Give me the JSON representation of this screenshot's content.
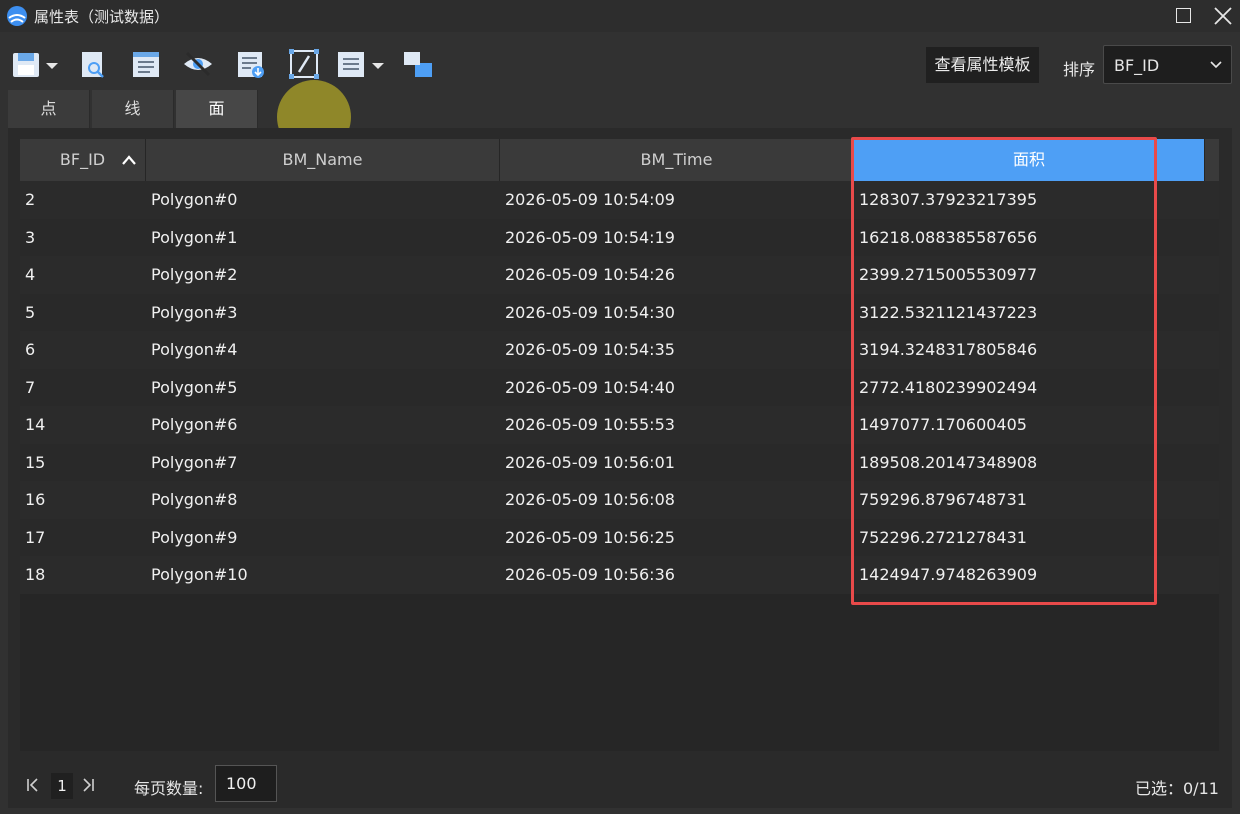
{
  "window": {
    "title": "属性表（测试数据）"
  },
  "toolbar": {
    "icons": [
      "save-icon",
      "chevron-down-icon",
      "search-document-icon",
      "list-view-icon",
      "eye-hide-icon",
      "export-icon",
      "edit-icon",
      "list-icon",
      "chevron-down-icon",
      "layers-icon"
    ],
    "template_button": "查看属性模板",
    "sort_label": "排序",
    "sort_value": "BF_ID"
  },
  "tabs": [
    {
      "label": "点",
      "active": false
    },
    {
      "label": "线",
      "active": false
    },
    {
      "label": "面",
      "active": true
    }
  ],
  "table": {
    "columns": [
      "BF_ID",
      "BM_Name",
      "BM_Time",
      "面积"
    ],
    "sorted_column": "BF_ID",
    "sort_direction": "ascending",
    "selected_column": "面积",
    "rows": [
      [
        "2",
        "Polygon#0",
        "2026-05-09 10:54:09",
        "128307.37923217395"
      ],
      [
        "3",
        "Polygon#1",
        "2026-05-09 10:54:19",
        "16218.088385587656"
      ],
      [
        "4",
        "Polygon#2",
        "2026-05-09 10:54:26",
        "2399.2715005530977"
      ],
      [
        "5",
        "Polygon#3",
        "2026-05-09 10:54:30",
        "3122.5321121437223"
      ],
      [
        "6",
        "Polygon#4",
        "2026-05-09 10:54:35",
        "3194.3248317805846"
      ],
      [
        "7",
        "Polygon#5",
        "2026-05-09 10:54:40",
        "2772.4180239902494"
      ],
      [
        "14",
        "Polygon#6",
        "2026-05-09 10:55:53",
        "1497077.170600405"
      ],
      [
        "15",
        "Polygon#7",
        "2026-05-09 10:56:01",
        "189508.20147348908"
      ],
      [
        "16",
        "Polygon#8",
        "2026-05-09 10:56:08",
        "759296.8796748731"
      ],
      [
        "17",
        "Polygon#9",
        "2026-05-09 10:56:25",
        "752296.2721278431"
      ],
      [
        "18",
        "Polygon#10",
        "2026-05-09 10:56:36",
        "1424947.9748263909"
      ]
    ]
  },
  "footer": {
    "current_page": "1",
    "per_page_label": "每页数量:",
    "per_page_value": "100",
    "selected_text": "已选：0/11"
  },
  "colors": {
    "accent": "#4e9ff5",
    "highlight": "#e84a4a",
    "background": "#313131"
  }
}
